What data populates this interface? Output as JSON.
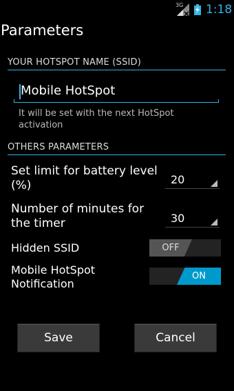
{
  "status_bar": {
    "network_label": "3G",
    "time": "1:18",
    "accent_color": "#33b5e5"
  },
  "page": {
    "title": "Parameters"
  },
  "hotspot_section": {
    "header": "YOUR HOTSPOT NAME (SSID)",
    "ssid_value": "Mobile HotSpot",
    "hint": "It will be set with the next HotSpot activation"
  },
  "others_section": {
    "header": "OTHERS PARAMETERS",
    "battery_label": "Set limit for battery level (%)",
    "battery_value": "20",
    "timer_label": "Number of minutes for the timer",
    "timer_value": "30",
    "hidden_ssid_label": "Hidden SSID",
    "hidden_ssid_state": "OFF",
    "notification_label": "Mobile HotSpot Notification",
    "notification_state": "ON"
  },
  "buttons": {
    "save": "Save",
    "cancel": "Cancel"
  },
  "icons": {
    "signal": "signal-icon",
    "battery": "battery-charging-icon"
  }
}
